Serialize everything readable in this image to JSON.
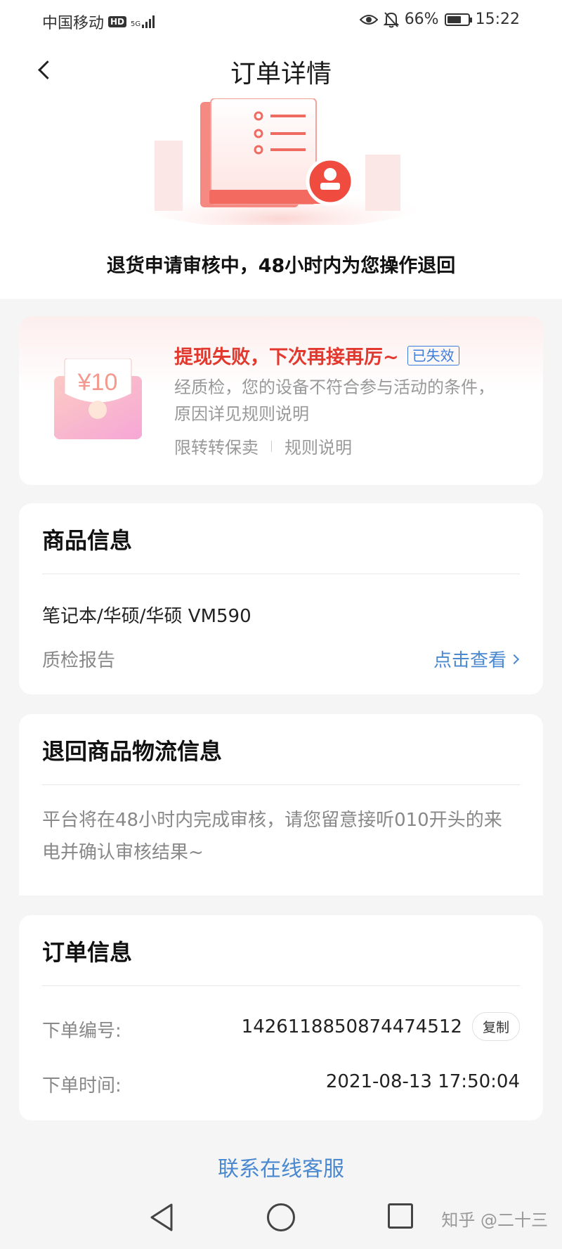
{
  "status_bar": {
    "carrier": "中国移动",
    "hd": "HD",
    "network": "5G",
    "battery": "66%",
    "time": "15:22"
  },
  "header": {
    "title": "订单详情"
  },
  "status_message": "退货申请审核中，48小时内为您操作退回",
  "promo": {
    "amount": "¥10",
    "title": "提现失败，下次再接再厉~",
    "badge": "已失效",
    "description": "经质检，您的设备不符合参与活动的条件，原因详见规则说明",
    "link_left": "限转转保卖",
    "link_right": "规则说明"
  },
  "goods": {
    "title": "商品信息",
    "name": "笔记本/华硕/华硕 VM590",
    "report_label": "质检报告",
    "report_link": "点击查看"
  },
  "logistics": {
    "title": "退回商品物流信息",
    "text": "平台将在48小时内完成审核，请您留意接听010开头的来电并确认审核结果~"
  },
  "order": {
    "title": "订单信息",
    "number_label": "下单编号:",
    "number_value": "1426118850874474512",
    "copy_label": "复制",
    "time_label": "下单时间:",
    "time_value": "2021-08-13 17:50:04"
  },
  "service_link": "联系在线客服",
  "watermark": "知乎 @二十三",
  "colors": {
    "accent_blue": "#4a88d0",
    "promo_red": "#e2382d"
  }
}
